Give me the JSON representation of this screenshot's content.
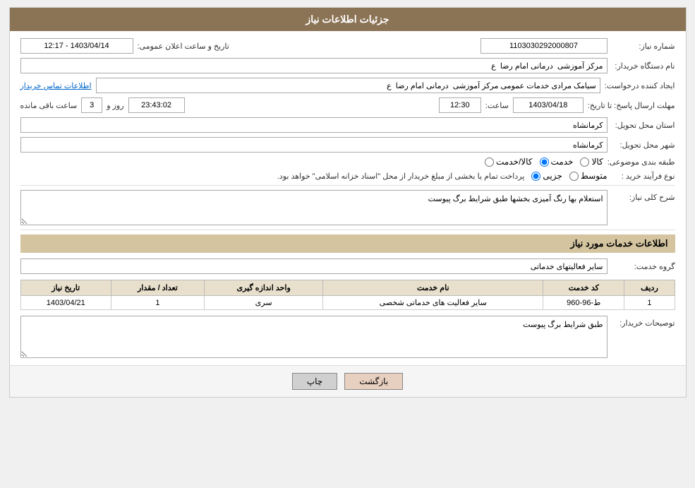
{
  "header": {
    "title": "جزئیات اطلاعات نیاز"
  },
  "fields": {
    "need_number_label": "شماره نیاز:",
    "need_number_value": "1103030292000807",
    "announce_datetime_label": "تاریخ و ساعت اعلان عمومی:",
    "announce_datetime_value": "1403/04/14 - 12:17",
    "buyer_org_label": "نام دستگاه خریدار:",
    "buyer_org_value": "مرکز آموزشی  درمانی امام رضا  ع",
    "creator_label": "ایجاد کننده درخواست:",
    "creator_value": "سیامک مرادی خدمات عمومی مرکز آموزشی  درمانی امام رضا  ع",
    "contact_link": "اطلاعات تماس خریدار",
    "deadline_label": "مهلت ارسال پاسخ: تا تاریخ:",
    "deadline_date": "1403/04/18",
    "deadline_time_label": "ساعت:",
    "deadline_time": "12:30",
    "deadline_days_label": "روز و",
    "deadline_days": "3",
    "deadline_remaining_label": "ساعت باقی مانده",
    "deadline_remaining": "23:43:02",
    "province_label": "استان محل تحویل:",
    "province_value": "کرمانشاه",
    "city_label": "شهر محل تحویل:",
    "city_value": "کرمانشاه",
    "category_label": "طبقه بندی موضوعی:",
    "category_options": [
      "کالا",
      "خدمت",
      "کالا/خدمت"
    ],
    "category_selected": "خدمت",
    "process_label": "نوع فرآیند خرید :",
    "process_options": [
      "جزیی",
      "متوسط"
    ],
    "process_text": "پرداخت تمام یا بخشی از مبلغ خریدار از محل \"اسناد خزانه اسلامی\" خواهد بود.",
    "description_label": "شرح کلی نیاز:",
    "description_value": "استعلام بها رنگ آمیزی بخشها طبق شرایط برگ پیوست"
  },
  "service_info": {
    "section_title": "اطلاعات خدمات مورد نیاز",
    "service_group_label": "گروه خدمت:",
    "service_group_value": "سایر فعالیتهای خدماتی",
    "table": {
      "columns": [
        "ردیف",
        "کد خدمت",
        "نام خدمت",
        "واحد اندازه گیری",
        "تعداد / مقدار",
        "تاریخ نیاز"
      ],
      "rows": [
        {
          "row": "1",
          "code": "ط-96-960",
          "name": "سایر فعالیت های خدماتی شخصی",
          "unit": "سری",
          "quantity": "1",
          "date": "1403/04/21"
        }
      ]
    }
  },
  "buyer_notes": {
    "label": "توصیحات خریدار:",
    "value": "طبق شرایط برگ پیوست"
  },
  "buttons": {
    "print": "چاپ",
    "back": "بازگشت"
  }
}
